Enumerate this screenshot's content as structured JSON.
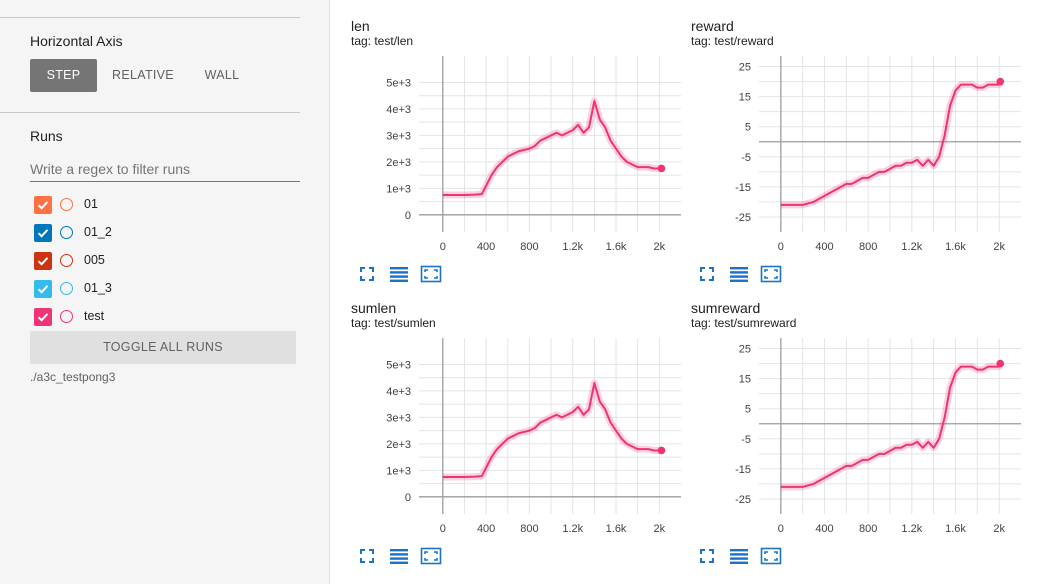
{
  "sidebar": {
    "horizontal_axis": {
      "title": "Horizontal Axis",
      "buttons": [
        "STEP",
        "RELATIVE",
        "WALL"
      ],
      "selected": "STEP"
    },
    "runs": {
      "title": "Runs",
      "filter_placeholder": "Write a regex to filter runs",
      "items": [
        {
          "name": "01",
          "color": "#ff7043",
          "checked": true
        },
        {
          "name": "01_2",
          "color": "#0077bb",
          "checked": true
        },
        {
          "name": "005",
          "color": "#cc3311",
          "checked": true
        },
        {
          "name": "01_3",
          "color": "#33bbee",
          "checked": true
        },
        {
          "name": "test",
          "color": "#ee3377",
          "checked": true
        }
      ],
      "toggle_label": "TOGGLE ALL RUNS",
      "logdir": "./a3c_testpong3"
    }
  },
  "accent_color": "#ee3377",
  "cards": [
    {
      "title": "len",
      "tag": "tag: test/len"
    },
    {
      "title": "reward",
      "tag": "tag: test/reward"
    },
    {
      "title": "sumlen",
      "tag": "tag: test/sumlen"
    },
    {
      "title": "sumreward",
      "tag": "tag: test/sumreward"
    }
  ],
  "chart_data": [
    {
      "type": "line",
      "title": "len",
      "x_ticks": [
        "0",
        "400",
        "800",
        "1.2k",
        "1.6k",
        "2k"
      ],
      "x_tick_values": [
        0,
        400,
        800,
        1200,
        1600,
        2000
      ],
      "y_ticks": [
        "0",
        "1e+3",
        "2e+3",
        "3e+3",
        "4e+3",
        "5e+3"
      ],
      "y_tick_values": [
        0,
        1000,
        2000,
        3000,
        4000,
        5000
      ],
      "xlim": [
        -220,
        2200
      ],
      "ylim": [
        -650,
        6000
      ],
      "series": [
        {
          "color": "#ee3377",
          "x": [
            0,
            100,
            200,
            300,
            360,
            400,
            450,
            500,
            550,
            600,
            650,
            700,
            750,
            800,
            850,
            900,
            950,
            1000,
            1050,
            1100,
            1150,
            1200,
            1250,
            1300,
            1350,
            1400,
            1450,
            1500,
            1550,
            1600,
            1650,
            1700,
            1750,
            1800,
            1850,
            1900,
            1950,
            2000,
            2020
          ],
          "y": [
            750,
            750,
            750,
            760,
            780,
            1100,
            1500,
            1800,
            2000,
            2200,
            2300,
            2400,
            2450,
            2500,
            2600,
            2800,
            2900,
            3000,
            3100,
            3000,
            3100,
            3200,
            3400,
            3100,
            3300,
            4300,
            3600,
            3300,
            2800,
            2500,
            2200,
            2000,
            1900,
            1800,
            1800,
            1800,
            1750,
            1750,
            1750
          ]
        }
      ]
    },
    {
      "type": "line",
      "title": "reward",
      "x_ticks": [
        "0",
        "400",
        "800",
        "1.2k",
        "1.6k",
        "2k"
      ],
      "x_tick_values": [
        0,
        400,
        800,
        1200,
        1600,
        2000
      ],
      "y_ticks": [
        "-25",
        "-15",
        "-5",
        "5",
        "15",
        "25"
      ],
      "y_tick_values": [
        -25,
        -15,
        -5,
        5,
        15,
        25
      ],
      "xlim": [
        -200,
        2200
      ],
      "ylim": [
        -30,
        28.5
      ],
      "series": [
        {
          "color": "#ee3377",
          "x": [
            0,
            100,
            200,
            300,
            350,
            400,
            450,
            500,
            550,
            600,
            650,
            700,
            750,
            800,
            850,
            900,
            950,
            1000,
            1050,
            1100,
            1150,
            1200,
            1250,
            1300,
            1350,
            1400,
            1450,
            1500,
            1550,
            1600,
            1650,
            1700,
            1750,
            1800,
            1850,
            1900,
            1950,
            2000,
            2010
          ],
          "y": [
            -21,
            -21,
            -21,
            -20,
            -19,
            -18,
            -17,
            -16,
            -15,
            -14,
            -14,
            -13,
            -12,
            -12,
            -11,
            -10,
            -10,
            -9,
            -8,
            -8,
            -7,
            -7,
            -6,
            -8,
            -6,
            -8,
            -5,
            2,
            12,
            17,
            19,
            19,
            19,
            18,
            18,
            19,
            19,
            19,
            20
          ]
        }
      ]
    },
    {
      "type": "line",
      "title": "sumlen",
      "x_ticks": [
        "0",
        "400",
        "800",
        "1.2k",
        "1.6k",
        "2k"
      ],
      "x_tick_values": [
        0,
        400,
        800,
        1200,
        1600,
        2000
      ],
      "y_ticks": [
        "0",
        "1e+3",
        "2e+3",
        "3e+3",
        "4e+3",
        "5e+3"
      ],
      "y_tick_values": [
        0,
        1000,
        2000,
        3000,
        4000,
        5000
      ],
      "xlim": [
        -220,
        2200
      ],
      "ylim": [
        -650,
        6000
      ],
      "series": [
        {
          "color": "#ee3377",
          "x": [
            0,
            100,
            200,
            300,
            360,
            400,
            450,
            500,
            550,
            600,
            650,
            700,
            750,
            800,
            850,
            900,
            950,
            1000,
            1050,
            1100,
            1150,
            1200,
            1250,
            1300,
            1350,
            1400,
            1450,
            1500,
            1550,
            1600,
            1650,
            1700,
            1750,
            1800,
            1850,
            1900,
            1950,
            2000,
            2020
          ],
          "y": [
            750,
            750,
            750,
            760,
            780,
            1100,
            1500,
            1800,
            2000,
            2200,
            2300,
            2400,
            2450,
            2500,
            2600,
            2800,
            2900,
            3000,
            3100,
            3000,
            3100,
            3200,
            3400,
            3100,
            3300,
            4300,
            3600,
            3300,
            2800,
            2500,
            2200,
            2000,
            1900,
            1800,
            1800,
            1800,
            1750,
            1750,
            1750
          ]
        }
      ]
    },
    {
      "type": "line",
      "title": "sumreward",
      "x_ticks": [
        "0",
        "400",
        "800",
        "1.2k",
        "1.6k",
        "2k"
      ],
      "x_tick_values": [
        0,
        400,
        800,
        1200,
        1600,
        2000
      ],
      "y_ticks": [
        "-25",
        "-15",
        "-5",
        "5",
        "15",
        "25"
      ],
      "y_tick_values": [
        -25,
        -15,
        -5,
        5,
        15,
        25
      ],
      "xlim": [
        -200,
        2200
      ],
      "ylim": [
        -30,
        28.5
      ],
      "series": [
        {
          "color": "#ee3377",
          "x": [
            0,
            100,
            200,
            300,
            350,
            400,
            450,
            500,
            550,
            600,
            650,
            700,
            750,
            800,
            850,
            900,
            950,
            1000,
            1050,
            1100,
            1150,
            1200,
            1250,
            1300,
            1350,
            1400,
            1450,
            1500,
            1550,
            1600,
            1650,
            1700,
            1750,
            1800,
            1850,
            1900,
            1950,
            2000,
            2010
          ],
          "y": [
            -21,
            -21,
            -21,
            -20,
            -19,
            -18,
            -17,
            -16,
            -15,
            -14,
            -14,
            -13,
            -12,
            -12,
            -11,
            -10,
            -10,
            -9,
            -8,
            -8,
            -7,
            -7,
            -6,
            -8,
            -6,
            -8,
            -5,
            2,
            12,
            17,
            19,
            19,
            19,
            18,
            18,
            19,
            19,
            19,
            20
          ]
        }
      ]
    }
  ]
}
